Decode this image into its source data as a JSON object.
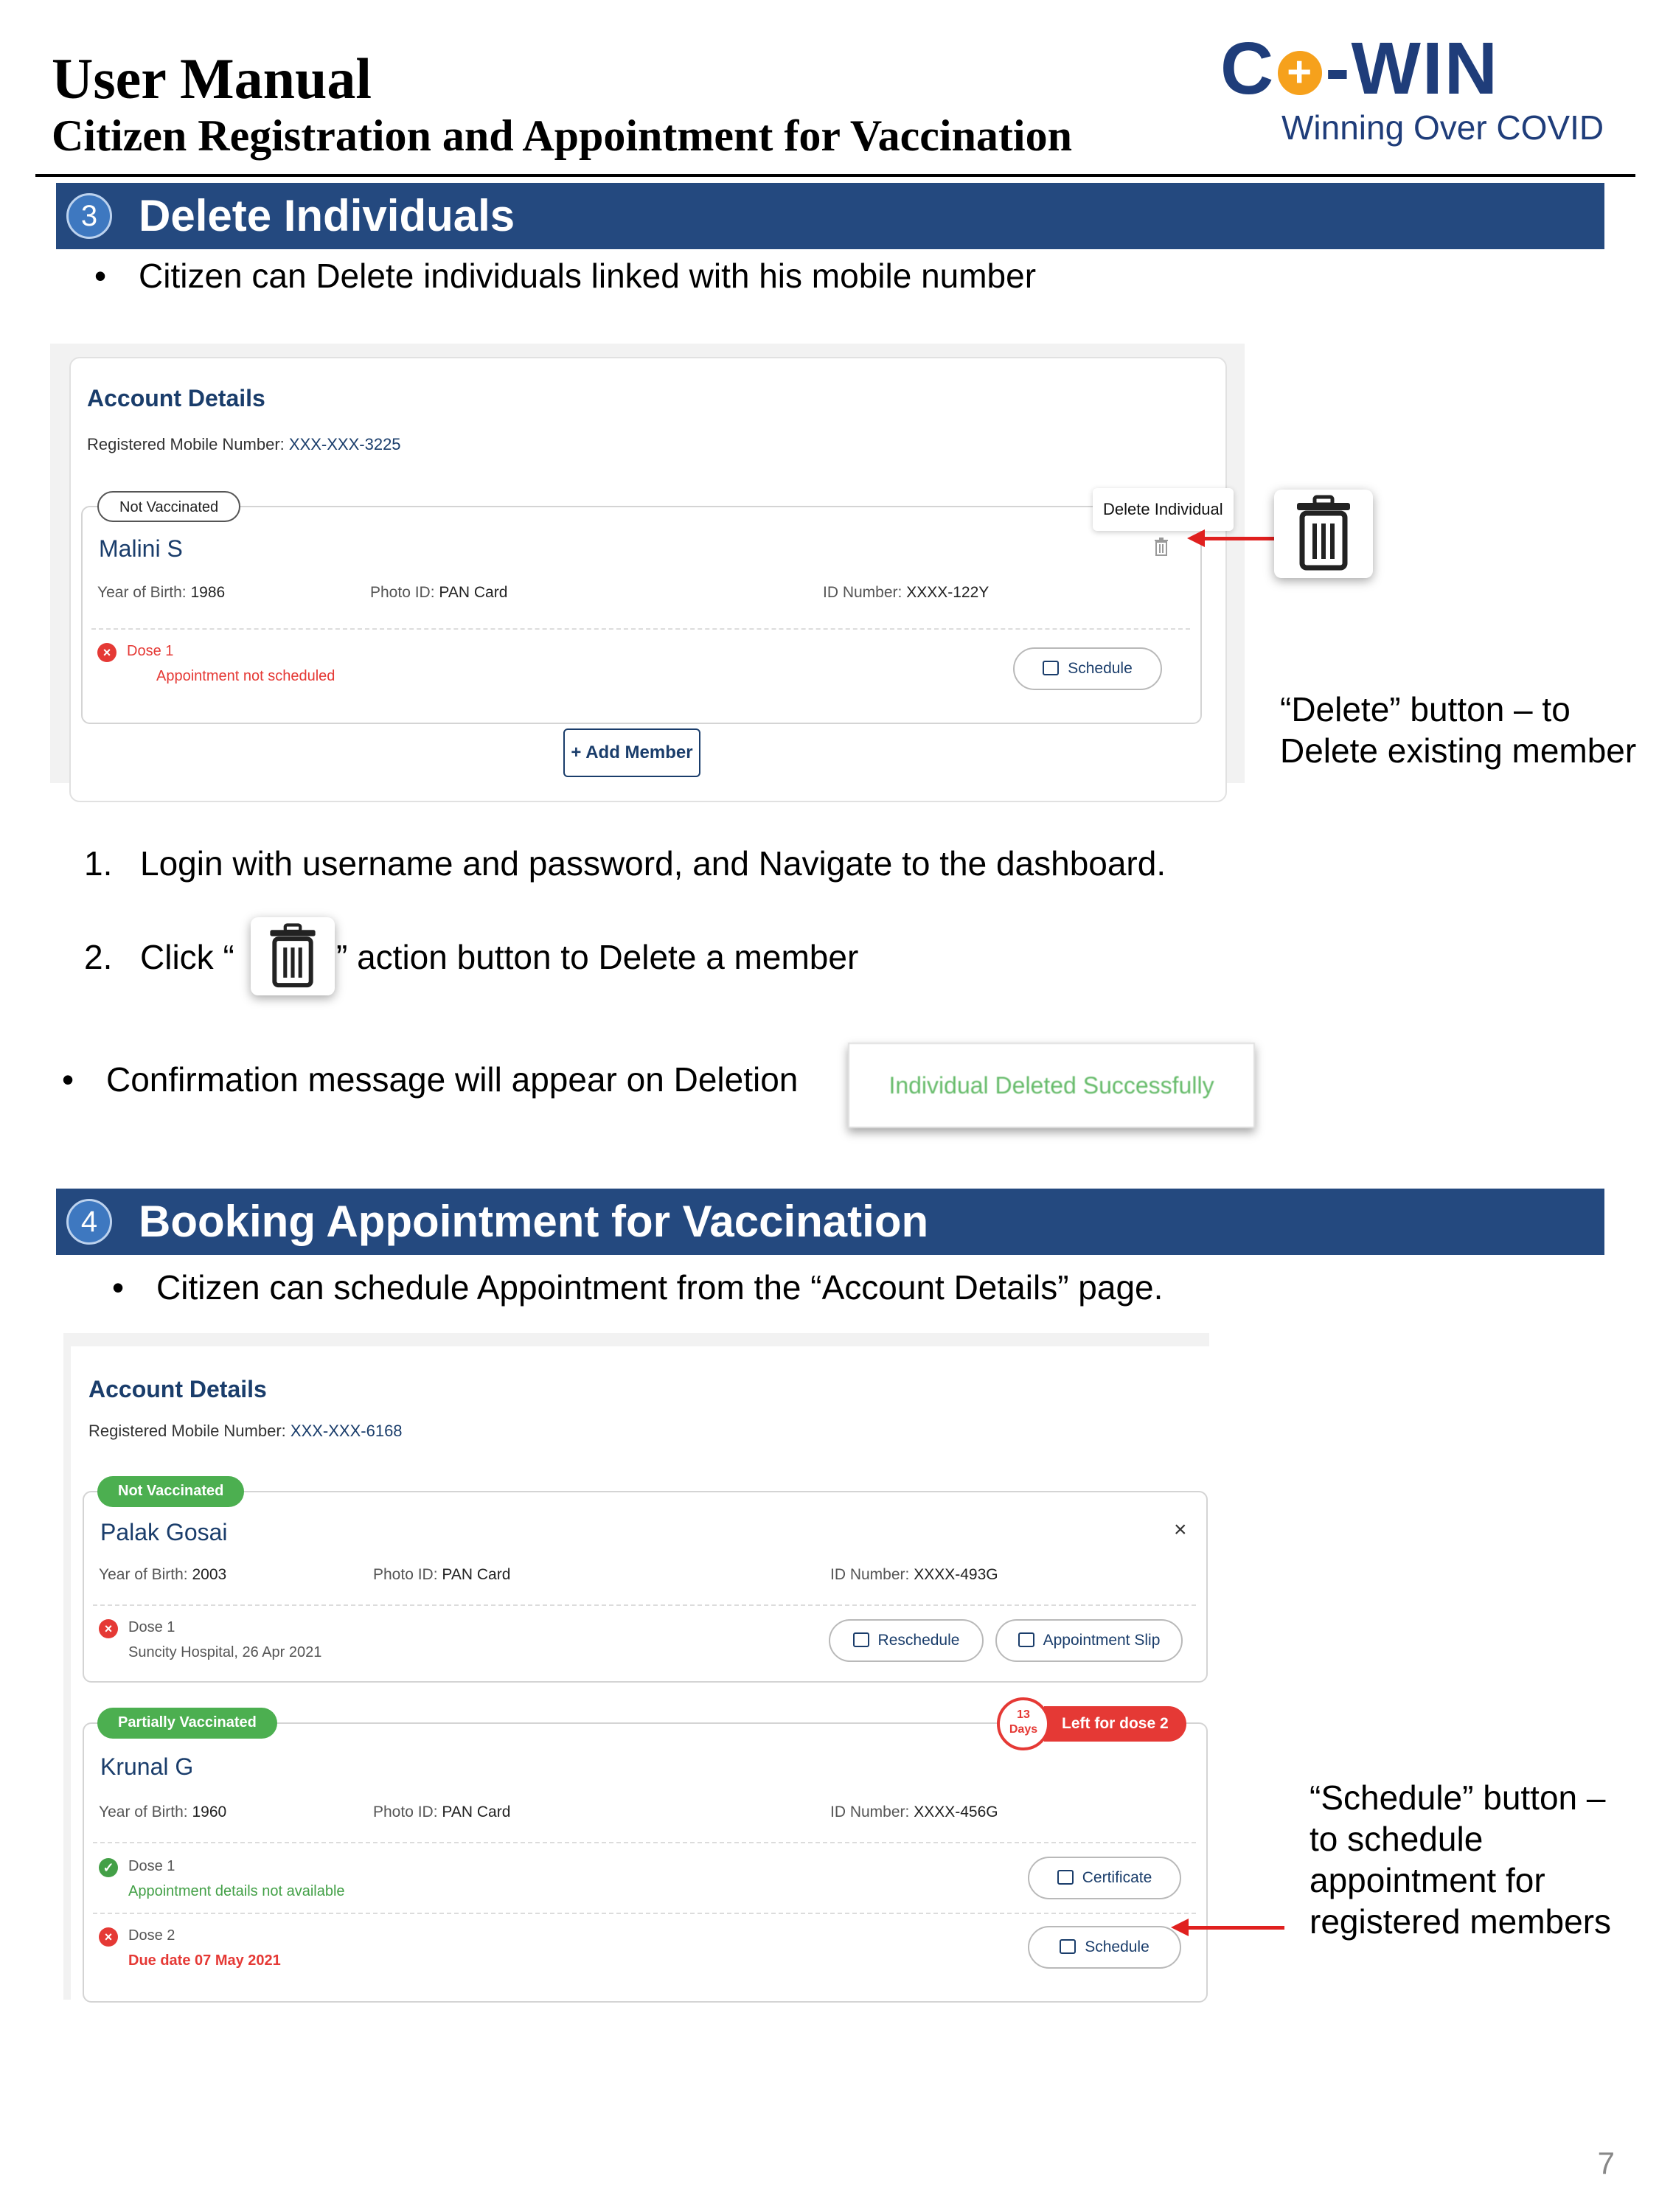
{
  "header": {
    "title": "User Manual",
    "subtitle": "Citizen Registration and Appointment for Vaccination",
    "logo_left": "C",
    "logo_right": "-WIN",
    "logo_tagline": "Winning Over COVID"
  },
  "section3": {
    "number": "3",
    "title": "Delete Individuals",
    "bullet": "Citizen can Delete individuals linked with his mobile number",
    "screenshot": {
      "title": "Account Details",
      "mobile_label": "Registered Mobile Number:",
      "mobile_value": "XXX-XXX-3225",
      "member": {
        "status": "Not Vaccinated",
        "name": "Malini S",
        "yob_label": "Year of Birth:",
        "yob": "1986",
        "photo_label": "Photo ID:",
        "photo": "PAN Card",
        "idnum_label": "ID Number:",
        "idnum": "XXXX-122Y",
        "dose_label": "Dose 1",
        "dose_status": "Appointment not scheduled",
        "schedule_label": "Schedule"
      },
      "tooltip": "Delete Individual",
      "add_member": "+ Add Member"
    },
    "note": "“Delete” button – to Delete existing member",
    "steps": [
      {
        "num": "1.",
        "text": "Login with username and password, and Navigate to the dashboard."
      },
      {
        "num": "2.",
        "text_before": "Click “",
        "text_after": "” action button to Delete a member"
      }
    ],
    "confirm_bullet": "Confirmation message will appear on Deletion",
    "toast": "Individual Deleted Successfully"
  },
  "section4": {
    "number": "4",
    "title": "Booking Appointment for Vaccination",
    "bullet": "Citizen can schedule Appointment from the “Account Details” page.",
    "screenshot": {
      "title": "Account Details",
      "mobile_label": "Registered Mobile Number:",
      "mobile_value": "XXX-XXX-6168",
      "members": [
        {
          "status": "Not Vaccinated",
          "name": "Palak Gosai",
          "close": "×",
          "yob_label": "Year of Birth:",
          "yob": "2003",
          "photo_label": "Photo ID:",
          "photo": "PAN Card",
          "idnum_label": "ID Number:",
          "idnum": "XXXX-493G",
          "dose_label": "Dose 1",
          "dose_detail": "Suncity Hospital, 26 Apr 2021",
          "btn1": "Reschedule",
          "btn2": "Appointment Slip"
        },
        {
          "status": "Partially Vaccinated",
          "name": "Krunal G",
          "days_num": "13",
          "days_label": "Days",
          "left_label": "Left for dose 2",
          "yob_label": "Year of Birth:",
          "yob": "1960",
          "photo_label": "Photo ID:",
          "photo": "PAN Card",
          "idnum_label": "ID Number:",
          "idnum": "XXXX-456G",
          "dose1_label": "Dose 1",
          "dose1_detail": "Appointment details not available",
          "dose1_btn": "Certificate",
          "dose2_label": "Dose 2",
          "dose2_detail": "Due date 07 May 2021",
          "dose2_btn": "Schedule"
        }
      ]
    },
    "note": "“Schedule” button – to  schedule appointment for registered members"
  },
  "colors": {
    "section_bar": "#24497f",
    "brand_blue": "#1f3d7a",
    "alert_red": "#e53935",
    "success_green": "#4caf50"
  },
  "icons": [
    "trash-icon",
    "calendar-icon",
    "close-icon",
    "check-icon",
    "cross-icon",
    "arrow-icon"
  ],
  "page_number": "7"
}
